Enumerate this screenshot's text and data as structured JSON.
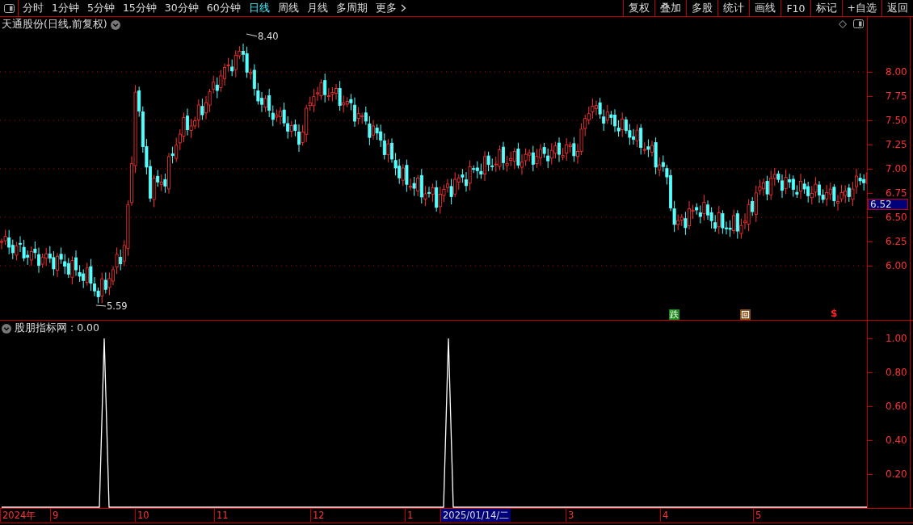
{
  "toolbar": {
    "tabs": [
      {
        "label": "分时",
        "selected": false
      },
      {
        "label": "1分钟",
        "selected": false
      },
      {
        "label": "5分钟",
        "selected": false
      },
      {
        "label": "15分钟",
        "selected": false
      },
      {
        "label": "30分钟",
        "selected": false
      },
      {
        "label": "60分钟",
        "selected": false
      },
      {
        "label": "日线",
        "selected": true
      },
      {
        "label": "周线",
        "selected": false
      },
      {
        "label": "月线",
        "selected": false
      },
      {
        "label": "多周期",
        "selected": false
      }
    ],
    "more": "更多",
    "buttons": [
      "复权",
      "叠加",
      "多股",
      "统计",
      "画线",
      "F10",
      "标记",
      "+自选",
      "返回"
    ]
  },
  "main_chart": {
    "title": "天通股份(日线,前复权)",
    "high_label": "8.40",
    "low_label": "5.59",
    "price_ticks": [
      "8.00",
      "7.75",
      "7.50",
      "7.25",
      "7.00",
      "6.75",
      "6.50",
      "6.25",
      "6.00"
    ],
    "current_price": "6.52",
    "markers": [
      {
        "kind": "badge",
        "text": "跌"
      },
      {
        "kind": "icon"
      },
      {
        "kind": "text",
        "text": "$"
      }
    ]
  },
  "indicator": {
    "title": "股朋指标网 : 0.00",
    "axis_ticks": [
      "1.00",
      "0.80",
      "0.60",
      "0.40",
      "0.20"
    ]
  },
  "time_axis": [
    {
      "label": "2024年",
      "highlighted": false
    },
    {
      "label": "9",
      "highlighted": false
    },
    {
      "label": "10",
      "highlighted": false
    },
    {
      "label": "11",
      "highlighted": false
    },
    {
      "label": "12",
      "highlighted": false
    },
    {
      "label": "1",
      "highlighted": false
    },
    {
      "label": "2025/01/14/二",
      "highlighted": true
    },
    {
      "label": "3",
      "highlighted": false
    },
    {
      "label": "4",
      "highlighted": false
    },
    {
      "label": "5",
      "highlighted": false
    }
  ]
}
